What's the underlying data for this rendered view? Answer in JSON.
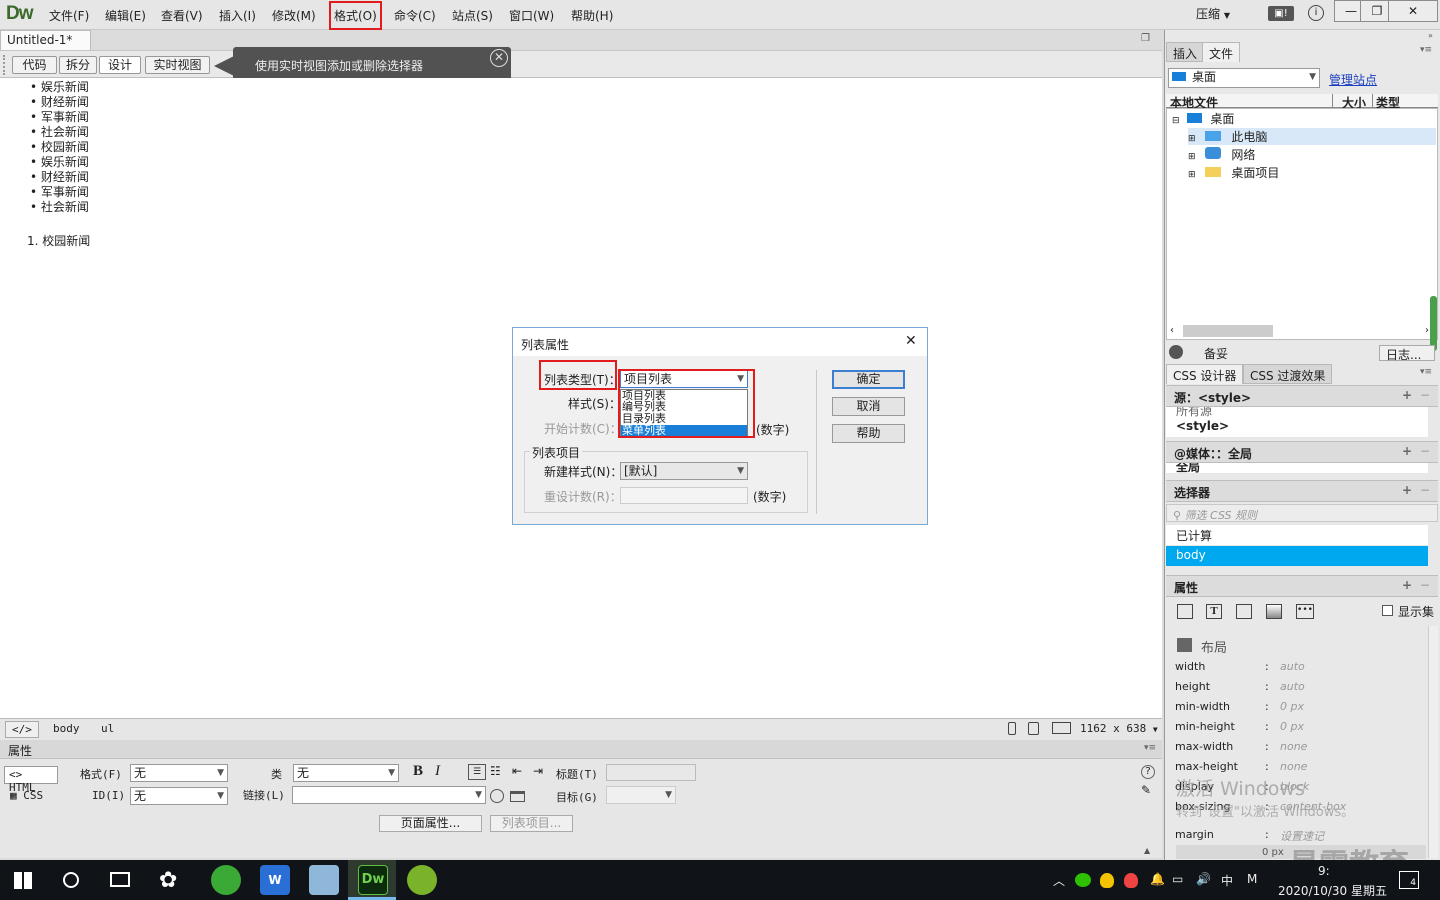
{
  "app": {
    "logo": "Dw",
    "layout_switcher": "压缩"
  },
  "menu": [
    "文件(F)",
    "编辑(E)",
    "查看(V)",
    "插入(I)",
    "修改(M)",
    "格式(O)",
    "命令(C)",
    "站点(S)",
    "窗口(W)",
    "帮助(H)"
  ],
  "document": {
    "tab_title": "Untitled-1*",
    "close": "×"
  },
  "view_buttons": [
    "代码",
    "拆分",
    "设计",
    "实时视图"
  ],
  "tooltip": "使用实时视图添加或删除选择器",
  "canvas": {
    "bullets": [
      "娱乐新闻",
      "财经新闻",
      "军事新闻",
      "社会新闻",
      "校园新闻",
      "娱乐新闻",
      "财经新闻",
      "军事新闻",
      "社会新闻"
    ],
    "numbered": [
      {
        "num": "1.",
        "text": "校园新闻"
      }
    ]
  },
  "status_bar": {
    "code_icon": "</>",
    "tags": [
      "body",
      "ul"
    ],
    "dimensions": "1162 x 638"
  },
  "properties": {
    "title": "属性",
    "html_btn": "HTML",
    "css_btn": "CSS",
    "format_label": "格式(F)",
    "format_value": "无",
    "id_label": "ID(I)",
    "id_value": "无",
    "class_label": "类",
    "class_value": "无",
    "link_label": "链接(L)",
    "title_label": "标题(T)",
    "target_label": "目标(G)",
    "page_props": "页面属性...",
    "list_item": "列表项目..."
  },
  "right_panel": {
    "tabs": [
      "插入",
      "文件"
    ],
    "location": "桌面",
    "manage": "管理站点",
    "cols": [
      "本地文件",
      "大小",
      "类型"
    ],
    "tree": [
      "桌面",
      "此电脑",
      "网络",
      "桌面项目"
    ],
    "backup": "备妥",
    "log": "日志...",
    "css_tabs": [
      "CSS 设计器",
      "CSS 过渡效果"
    ],
    "source_label": "源：<style>",
    "source_partial": "所有源",
    "source_item": "<style>",
    "media_label": "@媒体：：全局",
    "media_partial": "全局",
    "selector_label": "选择器",
    "filter_placeholder": "筛选 CSS 规则",
    "computed": "已计算",
    "body": "body",
    "props_label": "属性",
    "show_set": "显示集",
    "layout_label": "布局",
    "props": [
      {
        "name": "width",
        "value": "auto"
      },
      {
        "name": "height",
        "value": "auto"
      },
      {
        "name": "min-width",
        "value": "0 px"
      },
      {
        "name": "min-height",
        "value": "0 px"
      },
      {
        "name": "max-width",
        "value": "none"
      },
      {
        "name": "max-height",
        "value": "none"
      },
      {
        "name": "display",
        "value": "block"
      },
      {
        "name": "box-sizing",
        "value": "content-box"
      },
      {
        "name": "margin",
        "value": "设置速记"
      }
    ],
    "margin_val": "0 px"
  },
  "dialog": {
    "title": "列表属性",
    "list_type_label": "列表类型(T)：",
    "list_type_value": "项目列表",
    "style_label": "样式(S)：",
    "start_label": "开始计数(C)：",
    "start_unit": "(数字)",
    "options": [
      "项目列表",
      "编号列表",
      "目录列表",
      "菜单列表"
    ],
    "group_label": "列表项目",
    "new_style_label": "新建样式(N)：",
    "new_style_value": "[默认]",
    "reset_label": "重设计数(R)：",
    "reset_unit": "(数字)",
    "ok": "确定",
    "cancel": "取消",
    "help": "帮助"
  },
  "watermark": {
    "line1": "激活 Windows",
    "line2": "转到\"设置\"以激活 Windows。",
    "brand": "最需教育"
  },
  "taskbar": {
    "time": "9:",
    "date": "2020/10/30 星期五",
    "ime": "中",
    "ime2": "M",
    "notif": "4"
  },
  "colors": {
    "accent_red": "#e01c1c",
    "selection_blue": "#00a8f0",
    "dw_green": "#3a6b2a"
  }
}
